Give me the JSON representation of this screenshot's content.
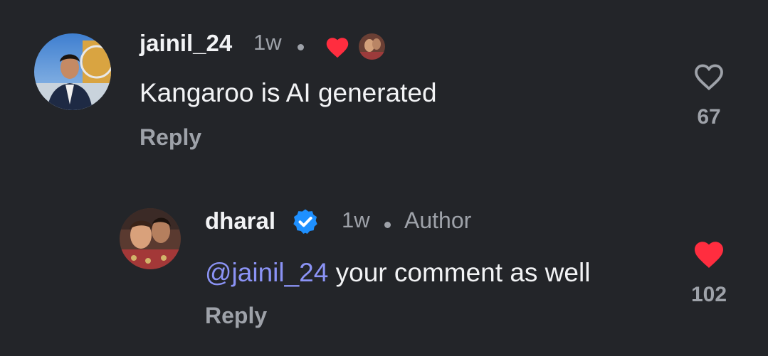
{
  "comments": [
    {
      "username": "jainil_24",
      "time": "1w",
      "text": "Kangaroo is AI generated",
      "reply_label": "Reply",
      "like_count": "67",
      "liked": false,
      "author_liked_icon": "red-heart-icon"
    },
    {
      "username": "dharal",
      "verified_icon": "verified-badge-icon",
      "time": "1w",
      "author_label": "Author",
      "mention": "@jainil_24",
      "text": " your comment as well",
      "reply_label": "Reply",
      "like_count": "102",
      "liked": true
    }
  ],
  "colors": {
    "background": "#232529",
    "primary_text": "#f2f3f5",
    "secondary_text": "#9ea2a9",
    "mention": "#8b93f5",
    "heart_red": "#ff2d3f",
    "verified_blue": "#1e90ff"
  }
}
